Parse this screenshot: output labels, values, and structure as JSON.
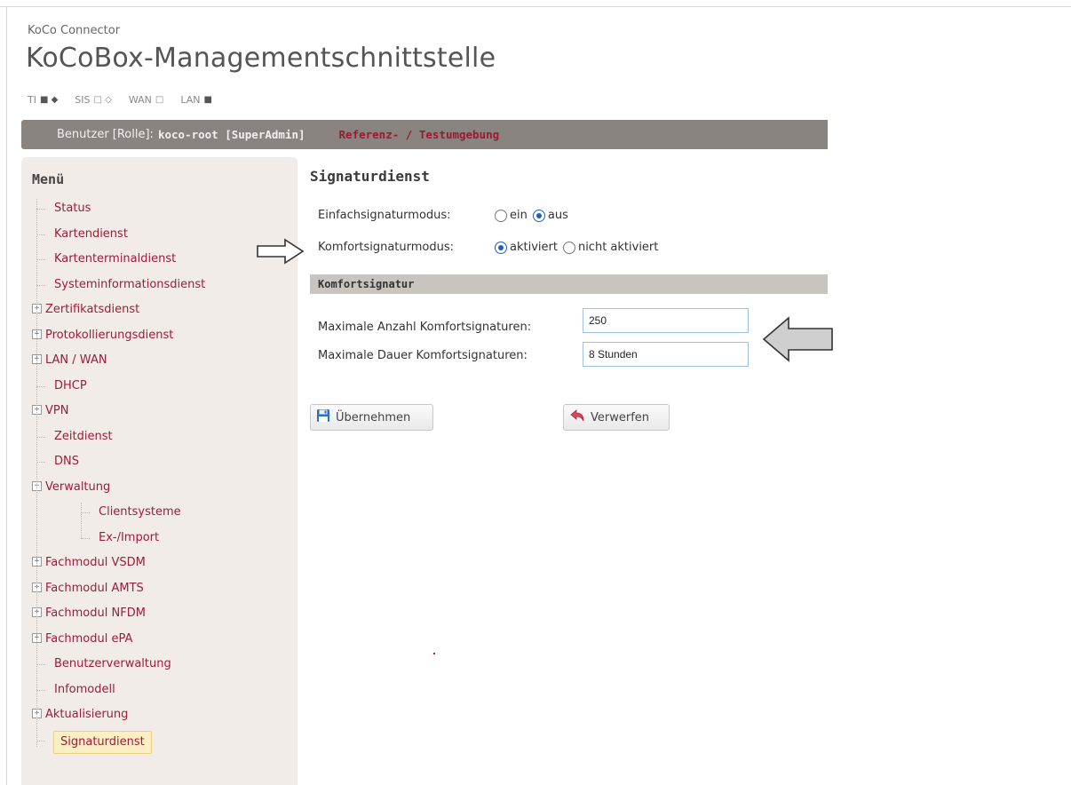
{
  "app": {
    "subtitle": "KoCo Connector",
    "title": "KoCoBox-Managementschnittstelle"
  },
  "status": [
    {
      "label": "TI",
      "symbols": "■ ◆"
    },
    {
      "label": "SIS",
      "symbols": "□ ◇"
    },
    {
      "label": "WAN",
      "symbols": "□"
    },
    {
      "label": "LAN",
      "symbols": "■"
    }
  ],
  "userbar": {
    "label": "Benutzer [Rolle]:",
    "user": "koco-root [SuperAdmin]",
    "environment": "Referenz- / Testumgebung"
  },
  "menu": {
    "title": "Menü",
    "items": [
      {
        "label": "Status",
        "expandable": false,
        "expanded": false,
        "level": 1
      },
      {
        "label": "Kartendienst",
        "expandable": false,
        "expanded": false,
        "level": 1
      },
      {
        "label": "Kartenterminaldienst",
        "expandable": false,
        "expanded": false,
        "level": 1
      },
      {
        "label": "Systeminformationsdienst",
        "expandable": false,
        "expanded": false,
        "level": 1
      },
      {
        "label": "Zertifikatsdienst",
        "expandable": true,
        "expanded": false,
        "level": 1
      },
      {
        "label": "Protokollierungsdienst",
        "expandable": true,
        "expanded": false,
        "level": 1
      },
      {
        "label": "LAN / WAN",
        "expandable": true,
        "expanded": false,
        "level": 1
      },
      {
        "label": "DHCP",
        "expandable": false,
        "expanded": false,
        "level": 1
      },
      {
        "label": "VPN",
        "expandable": true,
        "expanded": false,
        "level": 1
      },
      {
        "label": "Zeitdienst",
        "expandable": false,
        "expanded": false,
        "level": 1
      },
      {
        "label": "DNS",
        "expandable": false,
        "expanded": false,
        "level": 1
      },
      {
        "label": "Verwaltung",
        "expandable": true,
        "expanded": true,
        "level": 1
      },
      {
        "label": "Clientsysteme",
        "expandable": false,
        "expanded": false,
        "level": 2
      },
      {
        "label": "Ex-/Import",
        "expandable": false,
        "expanded": false,
        "level": 2
      },
      {
        "label": "Fachmodul VSDM",
        "expandable": true,
        "expanded": false,
        "level": 1
      },
      {
        "label": "Fachmodul AMTS",
        "expandable": true,
        "expanded": false,
        "level": 1
      },
      {
        "label": "Fachmodul NFDM",
        "expandable": true,
        "expanded": false,
        "level": 1
      },
      {
        "label": "Fachmodul ePA",
        "expandable": true,
        "expanded": false,
        "level": 1
      },
      {
        "label": "Benutzerverwaltung",
        "expandable": false,
        "expanded": false,
        "level": 1
      },
      {
        "label": "Infomodell",
        "expandable": false,
        "expanded": false,
        "level": 1
      },
      {
        "label": "Aktualisierung",
        "expandable": true,
        "expanded": false,
        "level": 1
      },
      {
        "label": "Signaturdienst",
        "expandable": false,
        "expanded": false,
        "level": 1,
        "active": true
      }
    ]
  },
  "main": {
    "title": "Signaturdienst",
    "einfach": {
      "label": "Einfachsignaturmodus:",
      "options": [
        "ein",
        "aus"
      ],
      "selected": "aus"
    },
    "komfort": {
      "label": "Komfortsignaturmodus:",
      "options": [
        "aktiviert",
        "nicht aktiviert"
      ],
      "selected": "aktiviert"
    },
    "group_title": "Komfortsignatur",
    "max_anzahl": {
      "label": "Maximale Anzahl Komfortsignaturen:",
      "value": "250"
    },
    "max_dauer": {
      "label": "Maximale Dauer Komfortsignaturen:",
      "value": "8 Stunden"
    },
    "buttons": {
      "apply": "Übernehmen",
      "discard": "Verwerfen"
    }
  },
  "colors": {
    "menu_link": "#9c1d3a",
    "userbar_bg": "#8a8480",
    "environment_text": "#9d1830",
    "sidebar_bg": "#f1ece8",
    "radio_selected": "#1f5fbf",
    "active_item_bg": "#fcefc4"
  },
  "icons": [
    "save-disk-icon",
    "undo-arrow-icon",
    "callout-arrow-right-icon",
    "callout-arrow-left-icon"
  ]
}
